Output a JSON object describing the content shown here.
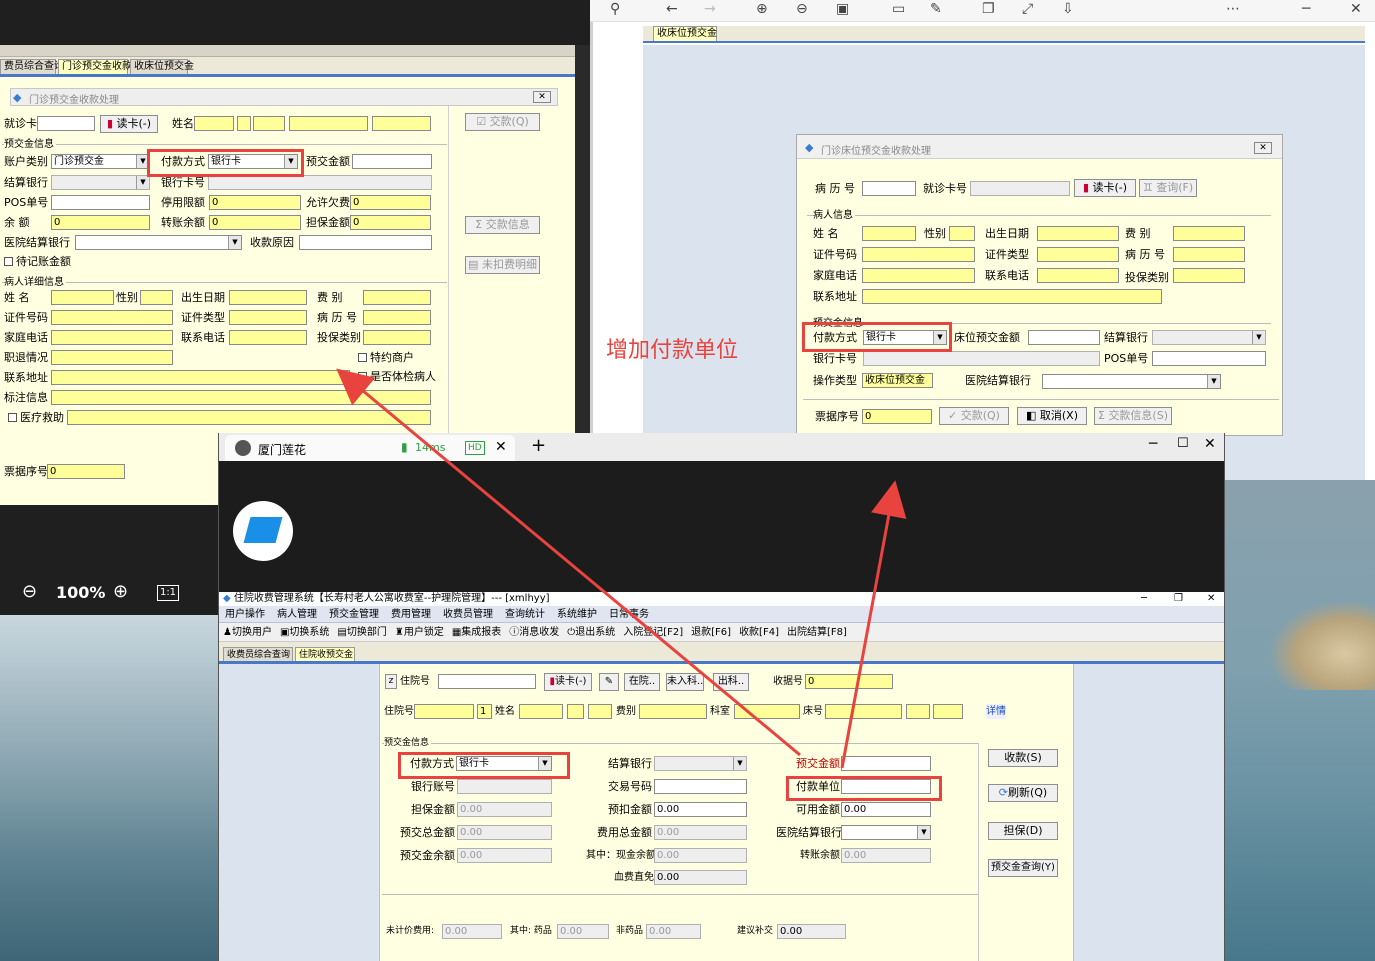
{
  "colors": {
    "annotation_red": "#e8433f",
    "yellow_field": "#ffff99",
    "form_bg": "#ffffe1",
    "accent_blue": "#4a78c8"
  },
  "annotation": {
    "text": "增加付款单位"
  },
  "left_window": {
    "tabs": [
      "费员综合查询",
      "门诊预交金收款",
      "收床位预交金"
    ],
    "dialog_title": "门诊预交金收款处理",
    "read_card": "读卡(-)",
    "labels": {
      "card_no": "就诊卡",
      "name": "姓名",
      "prepay_info": "预交金信息",
      "account_type": "账户类别",
      "pay_method": "付款方式",
      "prepay_amount": "预交金额",
      "settle_bank": "结算银行",
      "bank_card_no": "银行卡号",
      "pos_no": "POS单号",
      "stop_limit": "停用限额",
      "allow_owe": "允许欠费",
      "balance": "余    额",
      "transfer_balance": "转账余额",
      "guarantee_amount": "担保金额",
      "hospital_bank": "医院结算银行",
      "reason": "收款原因",
      "pending": "待记账金额",
      "patient_detail": "病人详细信息",
      "surname": "姓    名",
      "gender": "性别",
      "birth": "出生日期",
      "fee_type": "费    别",
      "id_no": "证件号码",
      "id_type": "证件类型",
      "record_no": "病 历 号",
      "home_phone": "家庭电话",
      "contact_phone": "联系电话",
      "insurance_type": "投保类别",
      "occupation": "职退情况",
      "special_merchant": "特约商户",
      "address": "联系地址",
      "is_checkup": "是否体检病人",
      "remark": "标注信息",
      "medical_aid": "医疗救助",
      "receipt_no": "票据序号"
    },
    "values": {
      "account_type": "门诊预交金",
      "pay_method": "银行卡",
      "stop_limit": "0",
      "allow_owe": "0",
      "balance": "0",
      "transfer_balance": "0",
      "guarantee_amount": "0",
      "receipt_no": "0"
    },
    "side_buttons": {
      "pay": "交款(Q)",
      "pay_info": "交款信息",
      "unpaid_detail": "未扣费明细"
    }
  },
  "right_window": {
    "tab": "收床位预交金",
    "dialog_title": "门诊床位预交金收款处理",
    "read_card": "读卡(-)",
    "query": "查询(F)",
    "labels": {
      "record_no": "病 历 号",
      "card_no": "就诊卡号",
      "patient_info": "病人信息",
      "surname": "姓    名",
      "gender": "性别",
      "birth": "出生日期",
      "fee_type": "费    别",
      "id_no": "证件号码",
      "id_type": "证件类型",
      "record_no2": "病 历 号",
      "home_phone": "家庭电话",
      "contact_phone": "联系电话",
      "insurance_type": "投保类别",
      "address": "联系地址",
      "prepay_info": "预交金信息",
      "pay_method": "付款方式",
      "bed_prepay_amount": "床位预交金额",
      "settle_bank": "结算银行",
      "bank_card_no": "银行卡号",
      "pos_no": "POS单号",
      "op_type": "操作类型",
      "hospital_bank": "医院结算银行",
      "receipt_no": "票据序号"
    },
    "values": {
      "pay_method": "银行卡",
      "op_type": "收床位预交金",
      "receipt_no": "0"
    },
    "buttons": {
      "pay": "交款(Q)",
      "cancel": "取消(X)",
      "pay_info": "交款信息(S)"
    }
  },
  "viewer_window": {
    "tab_title": "厦门莲花",
    "latency": "14ms",
    "hd": "HD",
    "new_tab": "+",
    "zoom": "100%",
    "zoom_one": "1:1",
    "app_title": "住院收费管理系统【长寿村老人公寓收费室--护理院管理】--- [xmlhyy]",
    "menu": [
      "用户操作",
      "病人管理",
      "预交金管理",
      "费用管理",
      "收费员管理",
      "查询统计",
      "系统维护",
      "日常事务"
    ],
    "toolbar": [
      "切换用户",
      "切换系统",
      "切换部门",
      "用户锁定",
      "集成报表",
      "消息收发",
      "退出系统",
      "入院登记[F2]",
      "退款[F6]",
      "收款[F4]",
      "出院结算[F8]"
    ],
    "tabs": [
      "收费员综合查询",
      "住院收预交金"
    ],
    "form": {
      "inpatient_no": "住院号",
      "read_card": "读卡(-)",
      "in_hosp": "在院..",
      "not_in": "未入科..",
      "out": "出科..",
      "receipt_no": "收据号",
      "receipt_value": "0",
      "inpatient_no2": "住院号",
      "seq": "1",
      "name": "姓名",
      "fee_type": "费别",
      "dept": "科室",
      "bed_no": "床号",
      "detail": "详情",
      "prepay_info": "预交金信息",
      "pay_method": "付款方式",
      "pay_method_value": "银行卡",
      "settle_bank": "结算银行",
      "prepay_amount": "预交金额",
      "bank_account": "银行账号",
      "txn_no": "交易号码",
      "pay_unit": "付款单位",
      "guarantee": "担保金额",
      "guarantee_value": "0.00",
      "pre_deduct": "预扣金额",
      "pre_deduct_value": "0.00",
      "available": "可用金额",
      "available_value": "0.00",
      "prepay_total": "预交总金额",
      "prepay_total_value": "0.00",
      "fee_total": "费用总金额",
      "fee_total_value": "0.00",
      "hospital_bank": "医院结算银行",
      "prepay_balance": "预交金余额",
      "prepay_balance_value": "0.00",
      "cash_balance": "其中：现金余额",
      "cash_balance_value": "0.00",
      "transfer_balance": "转账余额",
      "transfer_balance_value": "0.00",
      "blood_waiver": "血费直免",
      "blood_waiver_value": "0.00",
      "unbilled": "未计价费用:",
      "unbilled_value": "0.00",
      "drugs": "其中: 药品",
      "drugs_value": "0.00",
      "non_drugs": "非药品",
      "non_drugs_value": "0.00",
      "suggest": "建议补交",
      "suggest_value": "0.00",
      "btn_collect": "收款(S)",
      "btn_refresh": "刷新(Q)",
      "btn_guarantee": "担保(D)",
      "btn_prepay_query": "预交金查询(Y)"
    }
  }
}
